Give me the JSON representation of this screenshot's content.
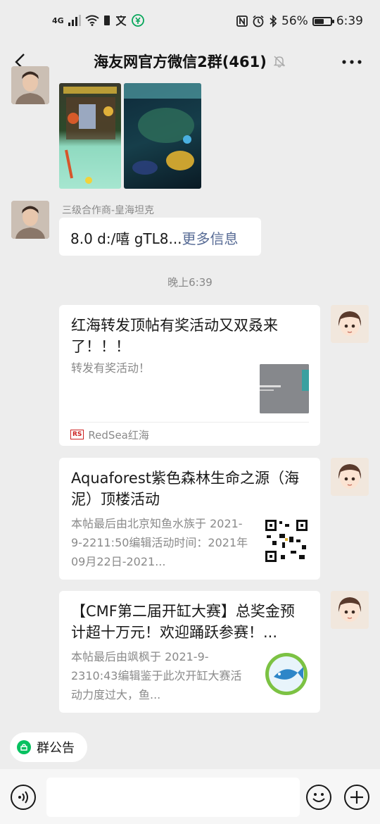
{
  "status_bar": {
    "network": "4G",
    "battery": "56%",
    "battery_level": 0.56,
    "time": "6:39"
  },
  "header": {
    "title": "海友网官方微信2群(461)"
  },
  "messages": {
    "sender_name": "三级合作商-皇海坦克",
    "text_body": "8.0 d:/嘻 gTL8...",
    "text_more": "更多信息",
    "timestamp": "晚上6:39"
  },
  "cards": [
    {
      "title": "红海转发顶帖有奖活动又双叒来了！！！",
      "desc": "转发有奖活动！",
      "source": "RedSea红海",
      "source_logo": "RS"
    },
    {
      "title": "Aquaforest紫色森林生命之源（海泥）顶楼活动",
      "desc": "本帖最后由北京知鱼水族于 2021-9-2211:50编辑活动时间：2021年09月22日-2021..."
    },
    {
      "title": "【CMF第二届开缸大赛】总奖金预计超十万元！欢迎踊跃参赛！...",
      "desc": "本帖最后由飒枫于 2021-9-2310:43编辑鉴于此次开缸大赛活动力度过大，鱼..."
    }
  ],
  "bottom": {
    "announcement_label": "群公告"
  },
  "colors": {
    "background": "#ededed",
    "link": "#576b95",
    "accent": "#07c160"
  }
}
